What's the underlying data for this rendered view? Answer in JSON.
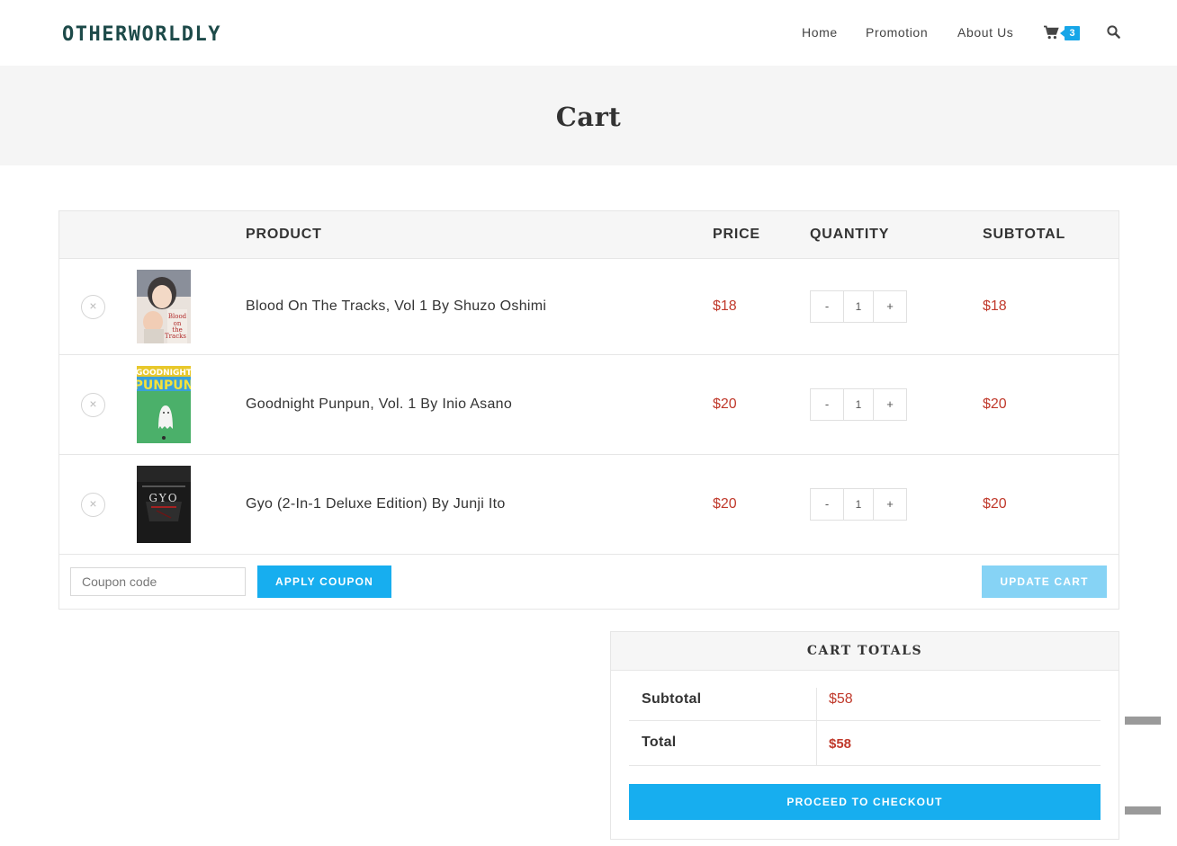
{
  "header": {
    "logo": "OTHERWORLDLY",
    "nav": [
      {
        "label": "Home"
      },
      {
        "label": "Promotion"
      },
      {
        "label": "About Us"
      }
    ],
    "cart_count": "3",
    "icons": {
      "cart": "shopping-cart-icon",
      "search": "magnifier-icon"
    }
  },
  "page": {
    "title": "Cart"
  },
  "table": {
    "headers": {
      "product": "PRODUCT",
      "price": "PRICE",
      "quantity": "QUANTITY",
      "subtotal": "SUBTOTAL"
    },
    "rows": [
      {
        "remove": "×",
        "name": "Blood On The Tracks, Vol 1 By Shuzo Oshimi",
        "price": "$18",
        "quantity": "1",
        "subtotal": "$18",
        "thumb_text": "Blood on the Tracks"
      },
      {
        "remove": "×",
        "name": "Goodnight Punpun, Vol. 1 By Inio Asano",
        "price": "$20",
        "quantity": "1",
        "subtotal": "$20",
        "thumb_text": "GOODNIGHT PUNPUN"
      },
      {
        "remove": "×",
        "name": "Gyo (2-In-1 Deluxe Edition) By Junji Ito",
        "price": "$20",
        "quantity": "1",
        "subtotal": "$20",
        "thumb_text": "GYO"
      }
    ],
    "qty_minus": "-",
    "qty_plus": "+",
    "coupon_placeholder": "Coupon code",
    "apply_coupon": "APPLY COUPON",
    "update_cart": "UPDATE CART"
  },
  "totals": {
    "title": "CART TOTALS",
    "subtotal_label": "Subtotal",
    "subtotal_value": "$58",
    "total_label": "Total",
    "total_value": "$58",
    "checkout": "PROCEED TO CHECKOUT"
  },
  "colors": {
    "accent": "#17aeef",
    "price": "#c0392b",
    "logo": "#1d4a49"
  }
}
